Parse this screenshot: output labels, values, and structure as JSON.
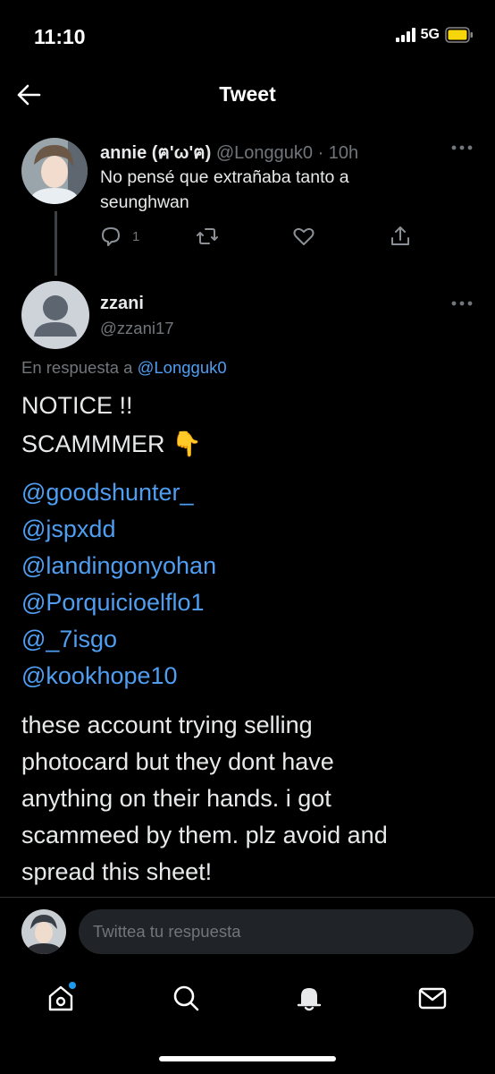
{
  "status_bar": {
    "time": "11:10",
    "network": "5G"
  },
  "header": {
    "title": "Tweet"
  },
  "parent_tweet": {
    "name": "annie (ฅ'ω'ฅ)",
    "handle": "@Longguk0",
    "time": "· 10h",
    "text_lines": [
      "No pensé que extrañaba tanto a",
      "seunghwan"
    ],
    "reply_count": "1"
  },
  "main_tweet": {
    "name": "zzani",
    "handle": "@zzani17",
    "reply_prefix": "En respuesta a",
    "reply_handle": "@Longguk0",
    "lines": [
      "NOTICE !!",
      "SCAMMMER 👇"
    ],
    "mentions": [
      "@goodshunter_",
      "@jspxdd",
      "@landingonyohan",
      "@Porquicioelflo1",
      "@_7isgo",
      "@kookhope10"
    ],
    "body": [
      "these account trying selling",
      "photocard but they dont have",
      "anything on their hands. i got",
      "scammeed by them. plz avoid and",
      "spread this sheet!"
    ]
  },
  "composer": {
    "placeholder": "Twittea tu respuesta"
  },
  "colors": {
    "background": "#000000",
    "link": "#4f9ef2",
    "muted": "#71767b",
    "notification_dot": "#1d9bf0"
  }
}
